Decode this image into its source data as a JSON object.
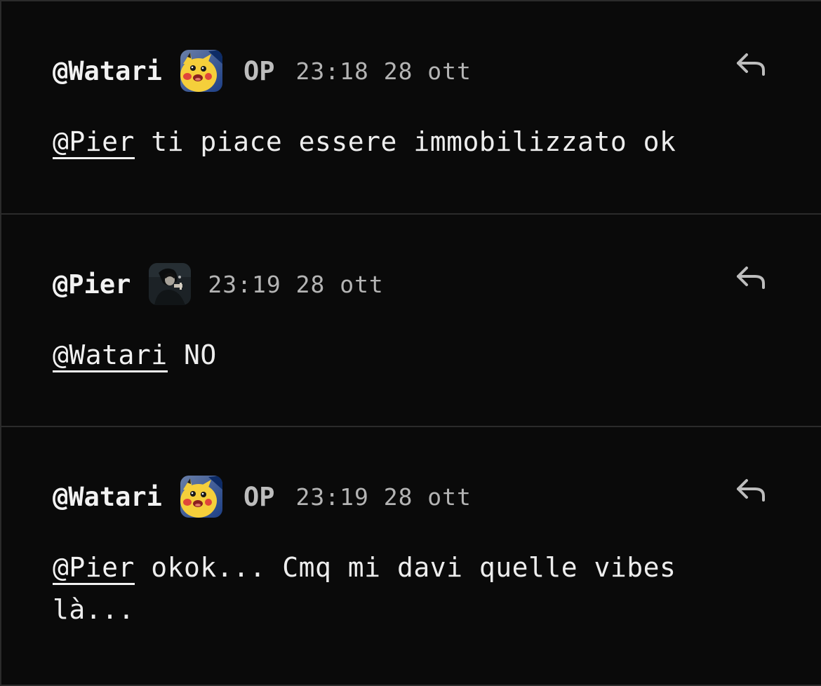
{
  "comments": [
    {
      "username": "@Watari",
      "avatar_icon": "pikachu-avatar-icon",
      "op_badge": "OP",
      "timestamp": "23:18 28 ott",
      "mention": "@Pier",
      "text": " ti piace essere immobilizzato ok",
      "reply_icon": "reply-arrow-icon"
    },
    {
      "username": "@Pier",
      "avatar_icon": "dark-portrait-avatar-icon",
      "op_badge": "",
      "timestamp": "23:19 28 ott",
      "mention": "@Watari",
      "text": " NO",
      "reply_icon": "reply-arrow-icon"
    },
    {
      "username": "@Watari",
      "avatar_icon": "pikachu-avatar-icon",
      "op_badge": "OP",
      "timestamp": "23:19 28 ott",
      "mention": "@Pier",
      "text": " okok... Cmq mi davi quelle vibes là...",
      "reply_icon": "reply-arrow-icon"
    }
  ],
  "colors": {
    "background": "#0a0a0a",
    "divider": "#2b2b2b",
    "text": "#ededed",
    "muted": "#b4b4b4"
  }
}
